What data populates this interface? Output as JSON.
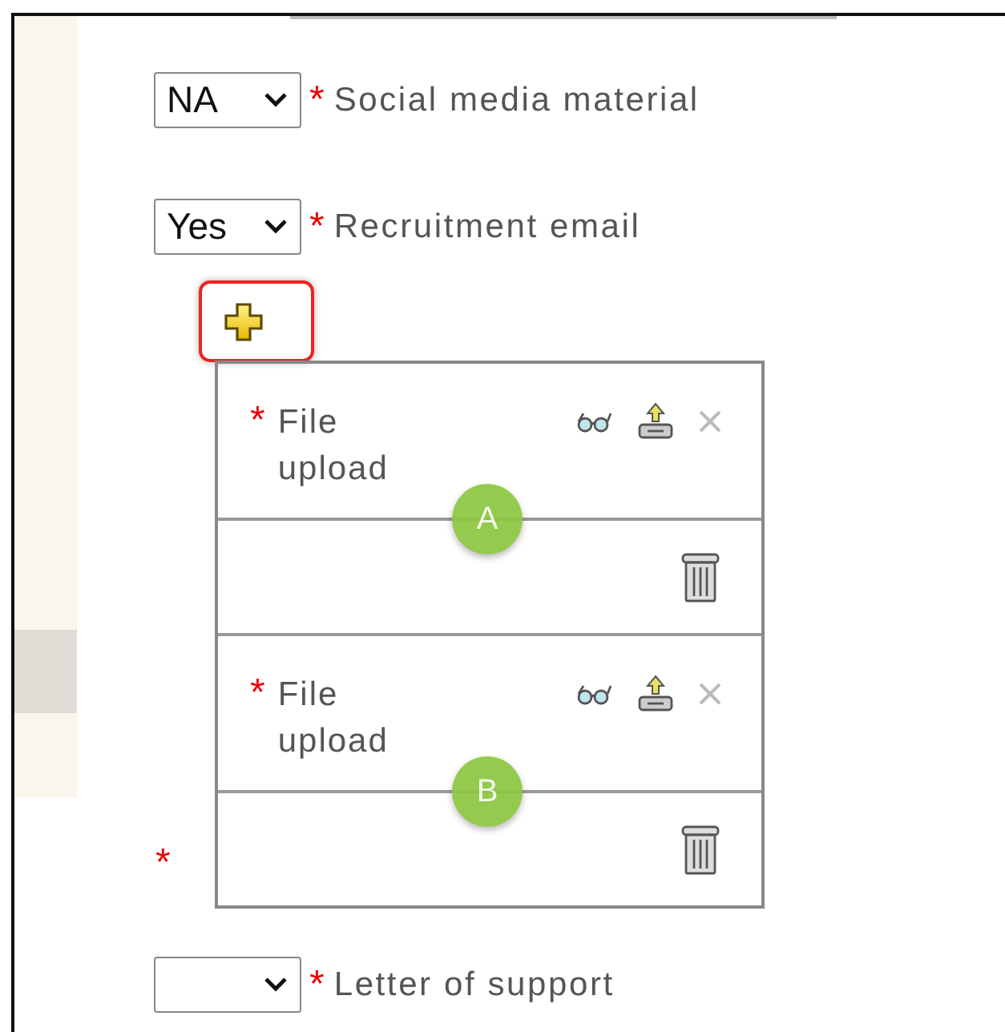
{
  "fields": [
    {
      "kind": "select",
      "value": "NA",
      "marker": "*",
      "label": "Social media material"
    },
    {
      "kind": "select",
      "value": "Yes",
      "marker": "*",
      "label": "Recruitment email"
    }
  ],
  "add_button": {
    "highlighted": true
  },
  "uploads": [
    {
      "marker": "*",
      "label": "File upload",
      "badge": "A"
    },
    {
      "marker": "*",
      "label": "File upload",
      "badge": "B"
    }
  ],
  "uploads_marker": "*",
  "last_field": {
    "kind": "select",
    "marker": "*",
    "label": "Letter of support"
  }
}
